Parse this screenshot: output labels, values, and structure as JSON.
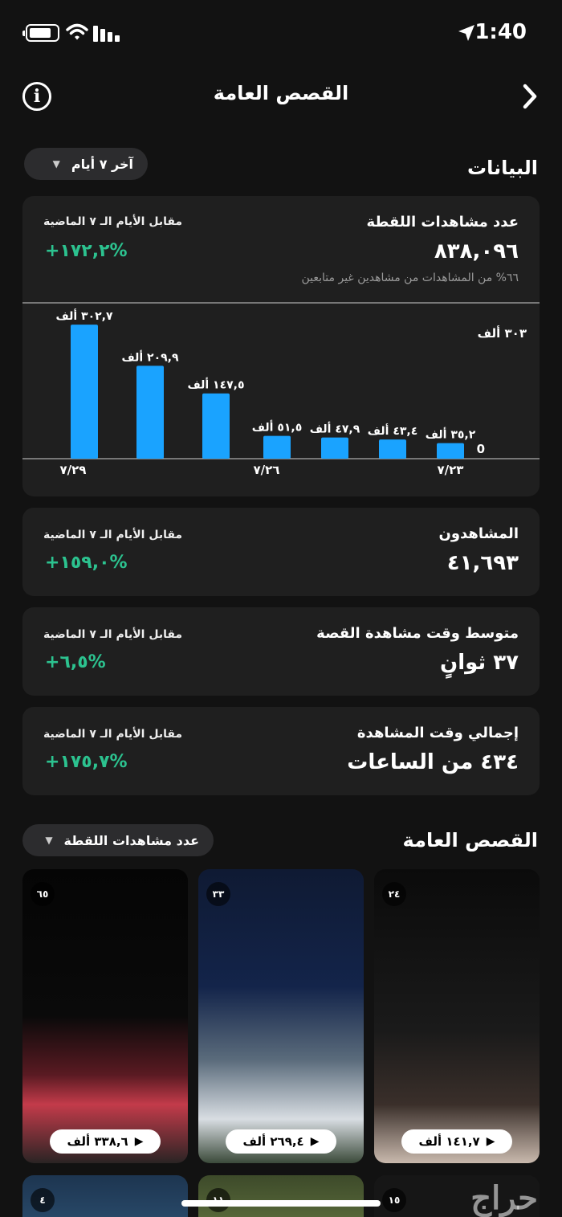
{
  "status_bar": {
    "time": "1:40"
  },
  "header": {
    "title": "القصص العامة"
  },
  "insights": {
    "section_title": "البيانات",
    "range_label": "آخر ٧ أيام"
  },
  "reach_card": {
    "label": "عدد مشاهدات اللقطة",
    "value": "٨٣٨,٠٩٦",
    "note": "٦٦% من المشاهدات من مشاهدين غير متابعين",
    "compare_label": "مقابل الأيام الـ ٧ الماضية",
    "compare_value": "+١٧٢,٢%"
  },
  "chart_data": {
    "type": "bar",
    "categories": [
      "7/23",
      "7/24",
      "7/25",
      "7/26",
      "7/27",
      "7/28",
      "7/29"
    ],
    "values": [
      35.2,
      43.4,
      47.9,
      51.5,
      147.5,
      209.9,
      302.7
    ],
    "data_labels": [
      "٣٥,٢ ألف",
      "٤٣,٤ ألف",
      "٤٧,٩ ألف",
      "٥١,٥ ألف",
      "١٤٧,٥ ألف",
      "٢٠٩,٩ ألف",
      "٣٠٢,٧ ألف"
    ],
    "x_tick_labels": [
      "٧/٢٣",
      "٧/٢٦",
      "٧/٢٩"
    ],
    "y_max_label": "٣٠٣ ألف",
    "y_min_label": "0",
    "ylim": [
      0,
      303
    ],
    "bar_color": "#1aa3ff"
  },
  "viewers_card": {
    "label": "المشاهدون",
    "value": "٤١,٦٩٣",
    "compare_label": "مقابل الأيام الـ ٧ الماضية",
    "compare_value": "+١٥٩,٠%"
  },
  "avg_time_card": {
    "label": "متوسط وقت مشاهدة القصة",
    "value": "٣٧ ثوانٍ",
    "compare_label": "مقابل الأيام الـ ٧ الماضية",
    "compare_value": "+٦,٥%"
  },
  "total_time_card": {
    "label": "إجمالي وقت المشاهدة",
    "value": "٤٣٤ من الساعات",
    "compare_label": "مقابل الأيام الـ ٧ الماضية",
    "compare_value": "+١٧٥,٧%"
  },
  "stories": {
    "section_title": "القصص العامة",
    "sort_label": "عدد مشاهدات اللقطة",
    "items": [
      {
        "rank": "٢٤",
        "views": "١٤١,٧ ألف"
      },
      {
        "rank": "٣٣",
        "views": "٢٦٩,٤ ألف"
      },
      {
        "rank": "٦٥",
        "views": "٣٣٨,٦ ألف"
      }
    ],
    "next_row": [
      {
        "rank": "١٥"
      },
      {
        "rank": "١١"
      },
      {
        "rank": "٤"
      }
    ]
  },
  "watermark": "حراج",
  "accent_color": "#2cc28f"
}
